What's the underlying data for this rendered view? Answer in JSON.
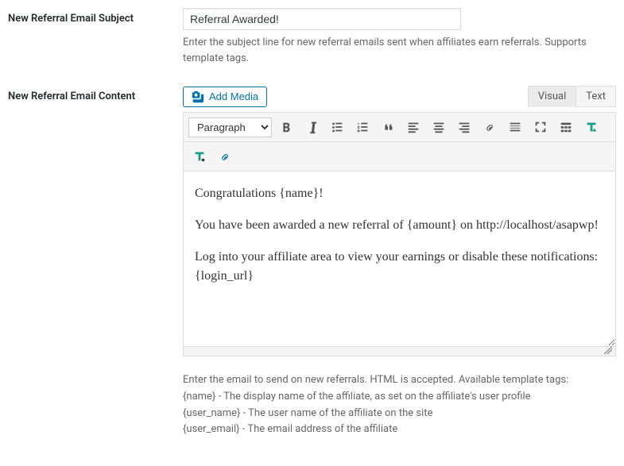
{
  "subject": {
    "label": "New Referral Email Subject",
    "value": "Referral Awarded!",
    "description": "Enter the subject line for new referral emails sent when affiliates earn referrals. Supports template tags."
  },
  "content": {
    "label": "New Referral Email Content",
    "add_media": "Add Media",
    "tabs": {
      "visual": "Visual",
      "text": "Text"
    },
    "format_select": "Paragraph",
    "body": {
      "p1": "Congratulations {name}!",
      "p2": "You have been awarded a new referral of {amount} on http://localhost/asapwp!",
      "p3": "Log into your affiliate area to view your earnings or disable these notifications: {login_url}"
    },
    "bottom": {
      "l1": "Enter the email to send on new referrals. HTML is accepted. Available template tags:",
      "l2": "{name} - The display name of the affiliate, as set on the affiliate's user profile",
      "l3": "{user_name} - The user name of the affiliate on the site",
      "l4": "{user_email} - The email address of the affiliate"
    }
  }
}
